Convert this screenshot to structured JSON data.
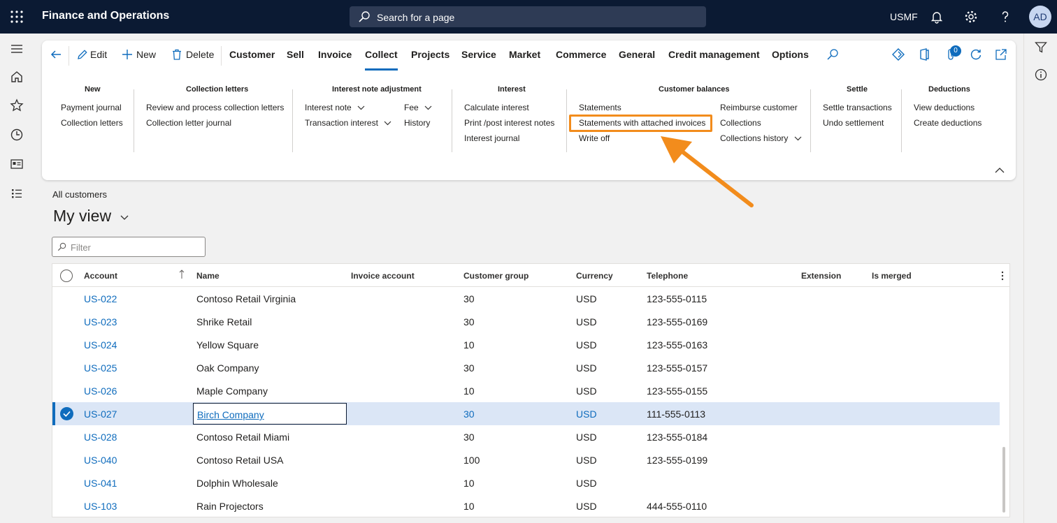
{
  "topbar": {
    "app_title": "Finance and Operations",
    "search_placeholder": "Search for a page",
    "company": "USMF",
    "avatar_initials": "AD"
  },
  "ribbon": {
    "actions": {
      "edit": "Edit",
      "new": "New",
      "delete": "Delete"
    },
    "tabs": [
      "Customer",
      "Sell",
      "Invoice",
      "Collect",
      "Projects",
      "Service",
      "Market",
      "Commerce",
      "General",
      "Credit management",
      "Options"
    ],
    "active_tab": "Collect",
    "attachments_count": "0",
    "groups": {
      "new": {
        "title": "New",
        "items": [
          "Payment journal",
          "Collection letters"
        ]
      },
      "collection_letters": {
        "title": "Collection letters",
        "items": [
          "Review and process collection letters",
          "Collection letter journal"
        ]
      },
      "interest_note_adjustment": {
        "title": "Interest note adjustment",
        "items": [
          "Interest note",
          "Transaction interest",
          "Fee",
          "History"
        ]
      },
      "interest": {
        "title": "Interest",
        "items": [
          "Calculate interest",
          "Print /post interest notes",
          "Interest journal"
        ]
      },
      "customer_balances": {
        "title": "Customer balances",
        "items": [
          "Statements",
          "Statements with attached invoices",
          "Write off",
          "Reimburse customer",
          "Collections",
          "Collections history"
        ]
      },
      "settle": {
        "title": "Settle",
        "items": [
          "Settle transactions",
          "Undo settlement"
        ]
      },
      "deductions": {
        "title": "Deductions",
        "items": [
          "View deductions",
          "Create deductions"
        ]
      }
    }
  },
  "page": {
    "breadcrumb": "All customers",
    "view_title": "My view",
    "filter_placeholder": "Filter"
  },
  "grid": {
    "columns": [
      "Account",
      "Name",
      "Invoice account",
      "Customer group",
      "Currency",
      "Telephone",
      "Extension",
      "Is merged"
    ],
    "rows": [
      {
        "account": "US-022",
        "name": "Contoso Retail Virginia",
        "group": "30",
        "currency": "USD",
        "phone": "123-555-0115"
      },
      {
        "account": "US-023",
        "name": "Shrike Retail",
        "group": "30",
        "currency": "USD",
        "phone": "123-555-0169"
      },
      {
        "account": "US-024",
        "name": "Yellow Square",
        "group": "10",
        "currency": "USD",
        "phone": "123-555-0163"
      },
      {
        "account": "US-025",
        "name": "Oak Company",
        "group": "30",
        "currency": "USD",
        "phone": "123-555-0157"
      },
      {
        "account": "US-026",
        "name": "Maple Company",
        "group": "10",
        "currency": "USD",
        "phone": "123-555-0155"
      },
      {
        "account": "US-027",
        "name": "Birch Company",
        "group": "30",
        "currency": "USD",
        "phone": "111-555-0113"
      },
      {
        "account": "US-028",
        "name": "Contoso Retail Miami",
        "group": "30",
        "currency": "USD",
        "phone": "123-555-0184"
      },
      {
        "account": "US-040",
        "name": "Contoso Retail USA",
        "group": "100",
        "currency": "USD",
        "phone": "123-555-0199"
      },
      {
        "account": "US-041",
        "name": "Dolphin Wholesale",
        "group": "10",
        "currency": "USD",
        "phone": ""
      },
      {
        "account": "US-103",
        "name": "Rain Projectors",
        "group": "10",
        "currency": "USD",
        "phone": "444-555-0110"
      }
    ]
  },
  "colors": {
    "topbar": "#0b1a33",
    "accent": "#0f6cbd",
    "highlight": "#f28c1c",
    "selected_row": "#dbe6f6"
  },
  "icons": [
    "waffle-icon",
    "search-icon",
    "bell-icon",
    "gear-icon",
    "help-icon",
    "hamburger-icon",
    "home-icon",
    "star-icon",
    "clock-icon",
    "workspace-icon",
    "list-icon",
    "back-icon",
    "pencil-icon",
    "plus-icon",
    "trash-icon",
    "filter-icon",
    "info-icon",
    "paperclip-icon",
    "refresh-icon",
    "open-new-icon"
  ]
}
